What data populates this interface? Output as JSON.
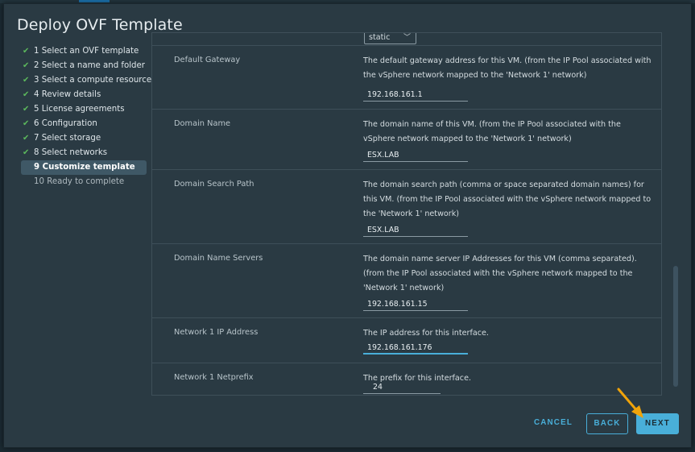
{
  "dialog": {
    "title": "Deploy OVF Template"
  },
  "steps": [
    {
      "label": "1 Select an OVF template",
      "done": true
    },
    {
      "label": "2 Select a name and folder",
      "done": true
    },
    {
      "label": "3 Select a compute resource",
      "done": true
    },
    {
      "label": "4 Review details",
      "done": true
    },
    {
      "label": "5 License agreements",
      "done": true
    },
    {
      "label": "6 Configuration",
      "done": true
    },
    {
      "label": "7 Select storage",
      "done": true
    },
    {
      "label": "8 Select networks",
      "done": true
    },
    {
      "label": "9 Customize template",
      "active": true
    },
    {
      "label": "10 Ready to complete",
      "pending": true
    }
  ],
  "check_symbol": "✔",
  "ip_allocation_select": {
    "value": "static",
    "chevron": "﹀"
  },
  "properties": [
    {
      "label": "Default Gateway",
      "description": "The default gateway address for this VM. (from the IP Pool associated with the vSphere network mapped to the 'Network 1' network)",
      "value": "192.168.161.1"
    },
    {
      "label": "Domain Name",
      "description": "The domain name of this VM. (from the IP Pool associated with the vSphere network mapped to the 'Network 1' network)",
      "value": "ESX.LAB"
    },
    {
      "label": "Domain Search Path",
      "description": "The domain search path (comma or space separated domain names) for this VM. (from the IP Pool associated with the vSphere network mapped to the 'Network 1' network)",
      "value": "ESX.LAB"
    },
    {
      "label": "Domain Name Servers",
      "description": "The domain name server IP Addresses for this VM (comma separated). (from the IP Pool associated with the vSphere network mapped to the 'Network 1' network)",
      "value": "192.168.161.15"
    },
    {
      "label": "Network 1 IP Address",
      "description": "The IP address for this interface.",
      "value": "192.168.161.176"
    },
    {
      "label": "Network 1 Netprefix",
      "description": "The prefix for this interface.",
      "value": "24"
    }
  ],
  "footer": {
    "cancel": "CANCEL",
    "back": "BACK",
    "next": "NEXT"
  },
  "colors": {
    "accent": "#49afd9",
    "check": "#5cb85c",
    "arrow": "#f0a30a"
  }
}
